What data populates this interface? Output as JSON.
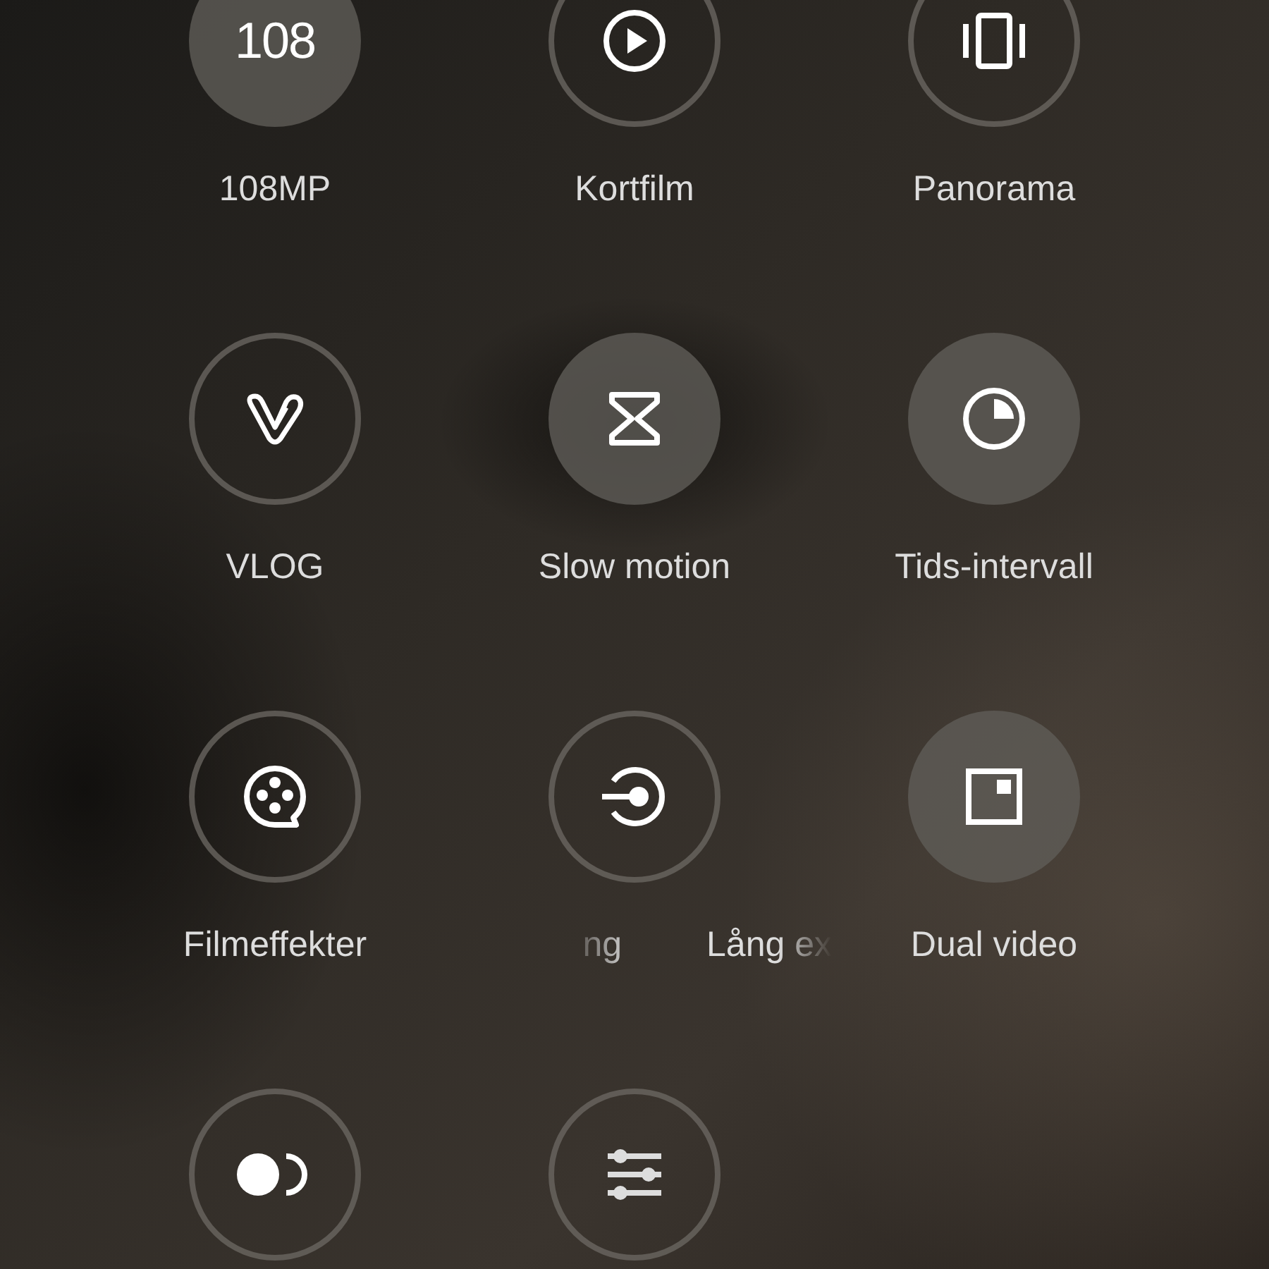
{
  "modes": [
    {
      "kind": "text",
      "glyph": "108",
      "label": "108MP",
      "highlighted": true
    },
    {
      "kind": "play",
      "label": "Kortfilm",
      "highlighted": false
    },
    {
      "kind": "panorama",
      "label": "Panorama",
      "highlighted": false
    },
    {
      "kind": "vlog",
      "label": "VLOG",
      "highlighted": false
    },
    {
      "kind": "hourglass",
      "label": "Slow motion",
      "highlighted": true
    },
    {
      "kind": "timer",
      "label": "Tids-intervall",
      "highlighted": true
    },
    {
      "kind": "film",
      "label": "Filmeffekter",
      "highlighted": false
    },
    {
      "kind": "exposure",
      "label_parts": [
        "ng",
        "Lång ex"
      ],
      "highlighted": false
    },
    {
      "kind": "dual",
      "label": "Dual video",
      "highlighted": true
    },
    {
      "kind": "toggle",
      "highlighted": false
    },
    {
      "kind": "sliders",
      "highlighted": false
    }
  ]
}
